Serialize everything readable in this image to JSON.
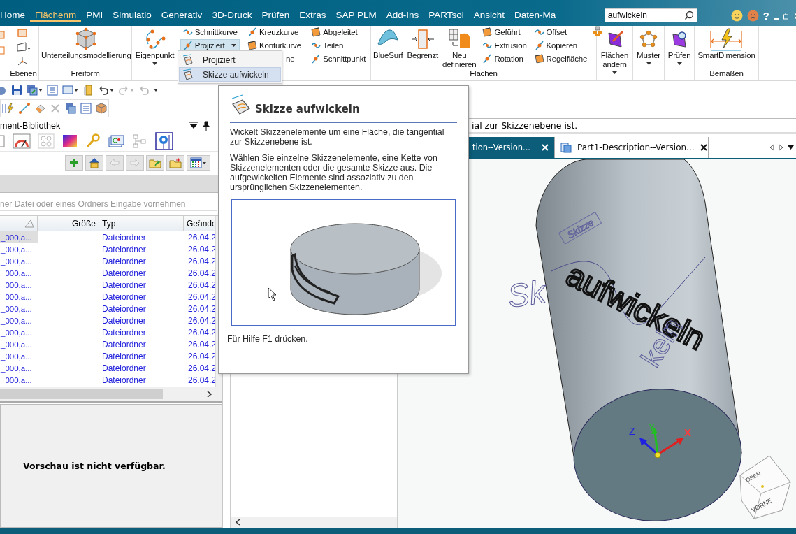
{
  "menu_tabs": [
    {
      "label": "Home",
      "selected": false
    },
    {
      "label": "Flächenm",
      "selected": true
    },
    {
      "label": "PMI",
      "selected": false
    },
    {
      "label": "Simulatio",
      "selected": false
    },
    {
      "label": "Generativ",
      "selected": false
    },
    {
      "label": "3D-Druck",
      "selected": false
    },
    {
      "label": "Prüfen",
      "selected": false
    },
    {
      "label": "Extras",
      "selected": false
    },
    {
      "label": "SAP PLM",
      "selected": false
    },
    {
      "label": "Add-Ins",
      "selected": false
    },
    {
      "label": "PARTsol",
      "selected": false
    },
    {
      "label": "Ansicht",
      "selected": false
    },
    {
      "label": "Daten-Ma",
      "selected": false
    }
  ],
  "search": {
    "value": "aufwickeln"
  },
  "help_label": "?",
  "ribbon": {
    "groups": [
      {
        "label": "Ebenen",
        "items": [
          {
            "kind": "icon_stack"
          }
        ]
      },
      {
        "label": "Freiform",
        "items": [
          {
            "kind": "large",
            "label": "Unterteilungsmodellierung",
            "dropdown": false
          }
        ]
      },
      {
        "items": [
          {
            "kind": "large",
            "label": "Eigenpunkt",
            "dropdown": true
          },
          {
            "kind": "column",
            "entries": [
              {
                "kind": "normal",
                "label": "Schnittkurve",
                "dropdown": false,
                "pressed": false
              },
              {
                "kind": "normal",
                "label": "Projiziert",
                "dropdown": true,
                "pressed": true
              }
            ]
          },
          {
            "kind": "column",
            "entries": [
              {
                "kind": "normal",
                "label": "Kreuzkurve",
                "dropdown": false,
                "pressed": false
              },
              {
                "kind": "normal",
                "label": "Konturkurve",
                "dropdown": false,
                "pressed": false
              },
              {
                "kind": "covered",
                "label": "ne",
                "dropdown": false,
                "pressed": false
              }
            ]
          },
          {
            "kind": "column",
            "entries": [
              {
                "kind": "normal",
                "label": "Abgeleitet",
                "dropdown": false,
                "pressed": false
              },
              {
                "kind": "normal",
                "label": "Teilen",
                "dropdown": false,
                "pressed": false
              },
              {
                "kind": "normal",
                "label": "Schnittpunkt",
                "dropdown": false,
                "pressed": false
              }
            ]
          }
        ]
      },
      {
        "label": "Flächen",
        "items": [
          {
            "kind": "large",
            "label": "BlueSurf",
            "dropdown": false
          },
          {
            "kind": "large",
            "label": "Begrenzt",
            "dropdown": false
          },
          {
            "kind": "large",
            "label": "Neu definieren",
            "dropdown": false
          },
          {
            "kind": "column",
            "entries": [
              {
                "kind": "normal",
                "label": "Geführt",
                "dropdown": false,
                "pressed": false
              },
              {
                "kind": "normal",
                "label": "Extrusion",
                "dropdown": false,
                "pressed": false
              },
              {
                "kind": "normal",
                "label": "Rotation",
                "dropdown": false,
                "pressed": false
              }
            ]
          },
          {
            "kind": "column",
            "entries": [
              {
                "kind": "normal",
                "label": "Offset",
                "dropdown": false,
                "pressed": false
              },
              {
                "kind": "normal",
                "label": "Kopieren",
                "dropdown": false,
                "pressed": false
              },
              {
                "kind": "normal",
                "label": "Regelfläche",
                "dropdown": false,
                "pressed": false
              }
            ]
          },
          {
            "kind": "icon_single"
          }
        ]
      },
      {
        "items": [
          {
            "kind": "large",
            "label": "Flächen ändern",
            "dropdown": true
          }
        ]
      },
      {
        "items": [
          {
            "kind": "large",
            "label": "Muster",
            "dropdown": true
          }
        ]
      },
      {
        "items": [
          {
            "kind": "large",
            "label": "Prüfen",
            "dropdown": true
          }
        ]
      },
      {
        "label": "Bemaßen",
        "items": [
          {
            "kind": "large",
            "label": "SmartDimension",
            "dropdown": false
          }
        ]
      }
    ]
  },
  "quick_access": [
    {
      "disabled": false
    },
    {
      "disabled": false
    },
    {
      "disabled": false
    },
    {
      "disabled": false
    },
    {
      "disabled": false
    },
    {
      "disabled": false
    },
    {
      "disabled": true
    },
    {
      "disabled": true
    }
  ],
  "dropdown_menu": {
    "items": [
      {
        "label": "Projiziert",
        "selected": false
      },
      {
        "label": "Skizze aufwickeln",
        "selected": true
      }
    ]
  },
  "library": {
    "title": "ment-Bibliothek",
    "nav_buttons": [
      {
        "disabled": false
      },
      {
        "disabled": false
      },
      {
        "disabled": true
      },
      {
        "disabled": true
      },
      {
        "disabled": false
      },
      {
        "disabled": false
      },
      {
        "disabled": false
      }
    ],
    "path_placeholder": "ner Datei oder eines Ordners Eingabe vornehmen",
    "columns": [
      "Größe",
      "Typ",
      "Geände"
    ],
    "rows": [
      {
        "name": "_000,a...",
        "type": "Dateiordner",
        "date": "26.04.2",
        "selected": true
      },
      {
        "name": "_000,a...",
        "type": "Dateiordner",
        "date": "26.04.2",
        "selected": false
      },
      {
        "name": "_000,a...",
        "type": "Dateiordner",
        "date": "26.04.2",
        "selected": false
      },
      {
        "name": "_000,a...",
        "type": "Dateiordner",
        "date": "26.04.2",
        "selected": false
      },
      {
        "name": "_000,a...",
        "type": "Dateiordner",
        "date": "26.04.2",
        "selected": false
      },
      {
        "name": "_000,a...",
        "type": "Dateiordner",
        "date": "26.04.2",
        "selected": false
      },
      {
        "name": "_000,a...",
        "type": "Dateiordner",
        "date": "26.04.2",
        "selected": false
      },
      {
        "name": "_000,a...",
        "type": "Dateiordner",
        "date": "26.04.2",
        "selected": false
      },
      {
        "name": "_000,a...",
        "type": "Dateiordner",
        "date": "26.04.2",
        "selected": false
      },
      {
        "name": "_000,a...",
        "type": "Dateiordner",
        "date": "26.04.2",
        "selected": false
      },
      {
        "name": "_000,a...",
        "type": "Dateiordner",
        "date": "26.04.2",
        "selected": false
      },
      {
        "name": "_000,a...",
        "type": "Dateiordner",
        "date": "26.04.2",
        "selected": false
      },
      {
        "name": "_000,a...",
        "type": "Dateiordner",
        "date": "26.04.2",
        "selected": false
      }
    ],
    "preview_message": "Vorschau ist nicht verfügbar."
  },
  "prompt": "ial zur Skizzenebene ist.",
  "doc_tabs": [
    {
      "label": "tion--Version...",
      "selected": true
    },
    {
      "label": "Part1-Description--Version...",
      "selected": false
    }
  ],
  "viewport": {
    "model_labels": [
      "Skizze",
      "Sk",
      "aufwickeln",
      "keln"
    ],
    "axes": [
      "X",
      "Y",
      "Z"
    ],
    "view_cube": [
      "OBEN",
      "VORNE"
    ]
  },
  "tooltip": {
    "title": "Skizze aufwickeln",
    "paragraphs": [
      "Wickelt Skizzenelemente um eine Fläche, die tangential zur Skizzenebene ist.",
      "Wählen Sie einzelne Skizzenelemente, eine Kette von Skizzenelementen oder die gesamte Skizze aus. Die aufgewickelten Elemente sind assoziativ zu den ursprünglichen Skizzenelementen."
    ],
    "footer": "Für Hilfe F1 drücken."
  }
}
